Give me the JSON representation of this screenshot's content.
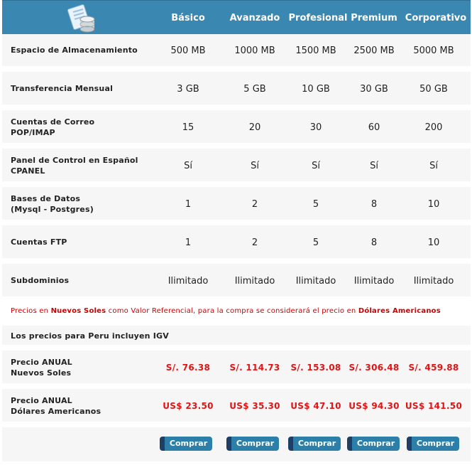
{
  "plans": [
    "Básico",
    "Avanzado",
    "Profesional",
    "Premium",
    "Corporativo"
  ],
  "rows": [
    {
      "label1": "Espacio de Almacenamiento",
      "label2": "",
      "values": [
        "500 MB",
        "1000 MB",
        "1500 MB",
        "2500 MB",
        "5000 MB"
      ]
    },
    {
      "label1": "Transferencia Mensual",
      "label2": "",
      "values": [
        "3 GB",
        "5 GB",
        "10 GB",
        "30 GB",
        "50 GB"
      ]
    },
    {
      "label1": "Cuentas de Correo",
      "label2": "POP/IMAP",
      "values": [
        "15",
        "20",
        "30",
        "60",
        "200"
      ]
    },
    {
      "label1": "Panel de Control en Español",
      "label2": "CPANEL",
      "values": [
        "Sí",
        "Sí",
        "Sí",
        "Sí",
        "Sí"
      ]
    },
    {
      "label1": "Bases de Datos",
      "label2": "(Mysql - Postgres)",
      "values": [
        "1",
        "2",
        "5",
        "8",
        "10"
      ]
    },
    {
      "label1": "Cuentas FTP",
      "label2": "",
      "values": [
        "1",
        "2",
        "5",
        "8",
        "10"
      ]
    },
    {
      "label1": "Subdominios",
      "label2": "",
      "values": [
        "Ilimitado",
        "Ilimitado",
        "Ilimitado",
        "Ilimitado",
        "Ilimitado"
      ]
    }
  ],
  "note": {
    "part1": "Precios en ",
    "bold1": "Nuevos Soles",
    "part2": " como Valor Referencial, para la compra se considerará el precio en ",
    "bold2": "Dólares Americanos"
  },
  "igv_text": "Los precios para Peru incluyen IGV",
  "prices": [
    {
      "label1": "Precio ANUAL",
      "label2": "Nuevos Soles",
      "values": [
        "S/. 76.38",
        "S/. 114.73",
        "S/. 153.08",
        "S/. 306.48",
        "S/. 459.88"
      ]
    },
    {
      "label1": "Precio ANUAL",
      "label2": "Dólares Americanos",
      "values": [
        "US$ 23.50",
        "US$ 35.30",
        "US$ 47.10",
        "US$ 94.30",
        "US$ 141.50"
      ]
    }
  ],
  "buy_label": "Comprar",
  "colors": {
    "header": "#3a87b1",
    "price": "#e01414",
    "button": "#2c7fa8",
    "row_bg": "#f6f6f6"
  }
}
